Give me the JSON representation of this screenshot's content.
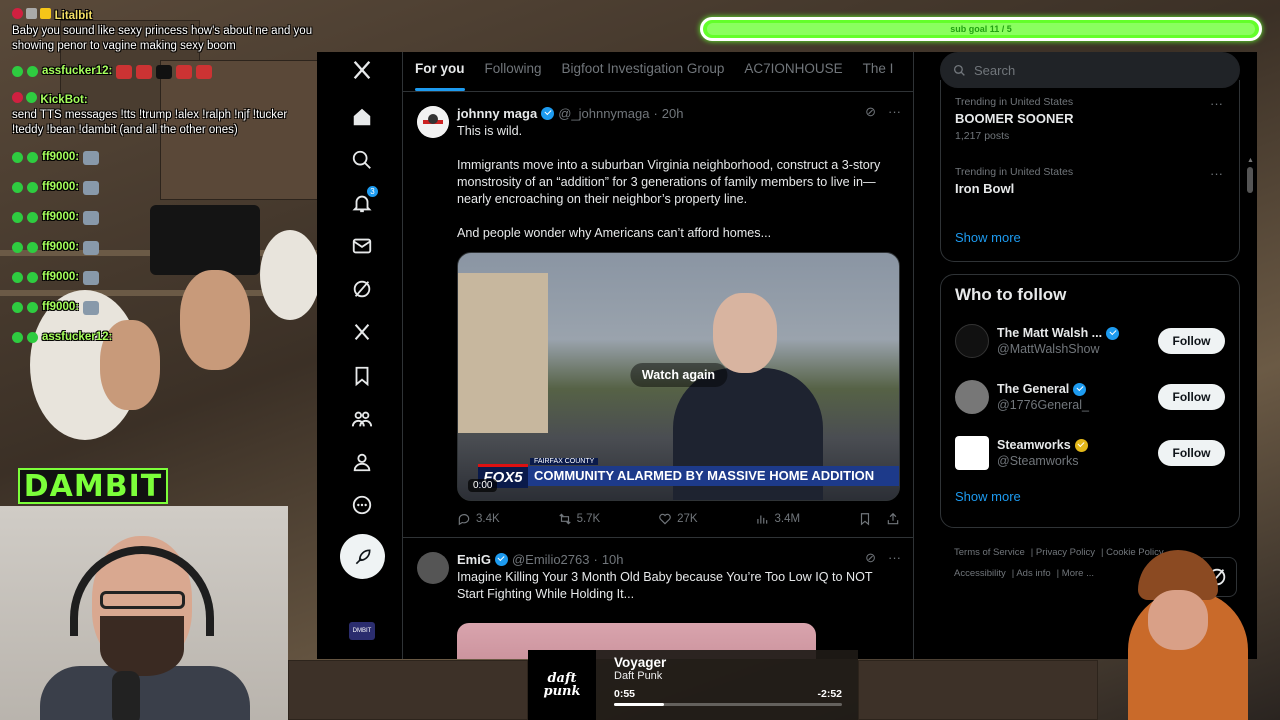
{
  "chat": {
    "messages": [
      {
        "user": "Litalbit",
        "text": "Baby you sound like sexy princess how's about ne and you showing penor to vagine making sexy boom"
      },
      {
        "user": "assfucker12:",
        "emotes": [
          "OAS",
          "OAS",
          "",
          "OAS",
          "OAS"
        ]
      },
      {
        "user": "KickBot:",
        "text": "send TTS messages !tts !trump !alex !ralph !njf !tucker !teddy !bean !dambit (and all the other ones)"
      },
      {
        "user": "ff9000:"
      },
      {
        "user": "ff9000:"
      },
      {
        "user": "ff9000:"
      },
      {
        "user": "ff9000:"
      },
      {
        "user": "ff9000:"
      },
      {
        "user": "ff9000:"
      },
      {
        "user": "assfucker12:"
      }
    ],
    "logo": "DAMBIT"
  },
  "subgoal": {
    "text": "sub goal 11 / 5"
  },
  "nav": {
    "notifications_count": "3",
    "avatar_label": "DMBIT"
  },
  "tabs": [
    "For you",
    "Following",
    "Bigfoot Investigation Group",
    "AC7IONHOUSE",
    "The I"
  ],
  "tweets": [
    {
      "name": "johnny maga",
      "handle": "@_johnnymaga",
      "time": "20h",
      "text": "This is wild.\n\nImmigrants move into a suburban Virginia neighborhood, construct a 3-story monstrosity of an “addition” for 3 generations of family members to live in—nearly encroaching on their neighbor’s property line.\n\nAnd people wonder why Americans can’t afford homes...",
      "media": {
        "overlay": "Watch again",
        "chyron": "COMMUNITY ALARMED BY MASSIVE HOME ADDITION",
        "chyron_top": "FAIRFAX COUNTY",
        "station": "FOX5",
        "time": "0:00"
      },
      "stats": {
        "replies": "3.4K",
        "reposts": "5.7K",
        "likes": "27K",
        "views": "3.4M"
      }
    },
    {
      "name": "EmiG",
      "handle": "@Emilio2763",
      "time": "10h",
      "text": "Imagine Killing Your 3 Month Old Baby because You’re Too Low IQ to NOT Start Fighting While Holding It..."
    }
  ],
  "search": {
    "placeholder": "Search"
  },
  "trends": [
    {
      "label": "Trending in United States",
      "name": "BOOMER SOONER",
      "count": "1,217 posts"
    },
    {
      "label": "Trending in United States",
      "name": "Iron Bowl",
      "count": ""
    }
  ],
  "show_more": "Show more",
  "who_to_follow": {
    "title": "Who to follow",
    "items": [
      {
        "name": "The Matt Walsh ...",
        "handle": "@MattWalshShow",
        "button": "Follow"
      },
      {
        "name": "The General",
        "handle": "@1776General_",
        "button": "Follow"
      },
      {
        "name": "Steamworks",
        "handle": "@Steamworks",
        "button": "Follow"
      }
    ],
    "show_more": "Show more"
  },
  "footer": {
    "links": [
      "Terms of Service",
      "Privacy Policy",
      "Cookie Policy",
      "Accessibility",
      "Ads info",
      "More ..."
    ]
  },
  "player": {
    "title": "Voyager",
    "artist": "Daft Punk",
    "position": "0:55",
    "remaining": "-2:52",
    "progress": 0.22,
    "album_art_text": "daft punk"
  },
  "colors": {
    "accent": "#1d9bf0",
    "goal_green": "#63ff2a",
    "chat_user": "#a6ff5c"
  }
}
